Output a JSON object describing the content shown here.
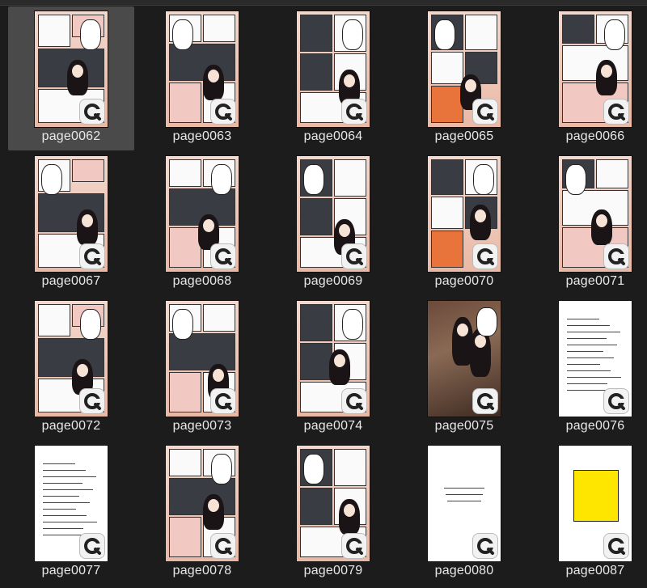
{
  "view": "thumbnail-grid",
  "selected_index": 0,
  "pages": [
    {
      "label": "page0062",
      "kind": "manga"
    },
    {
      "label": "page0063",
      "kind": "manga"
    },
    {
      "label": "page0064",
      "kind": "manga"
    },
    {
      "label": "page0065",
      "kind": "manga"
    },
    {
      "label": "page0066",
      "kind": "manga"
    },
    {
      "label": "page0067",
      "kind": "manga"
    },
    {
      "label": "page0068",
      "kind": "manga"
    },
    {
      "label": "page0069",
      "kind": "manga"
    },
    {
      "label": "page0070",
      "kind": "manga"
    },
    {
      "label": "page0071",
      "kind": "manga"
    },
    {
      "label": "page0072",
      "kind": "manga"
    },
    {
      "label": "page0073",
      "kind": "manga"
    },
    {
      "label": "page0074",
      "kind": "manga"
    },
    {
      "label": "page0075",
      "kind": "illustration"
    },
    {
      "label": "page0076",
      "kind": "text"
    },
    {
      "label": "page0077",
      "kind": "text"
    },
    {
      "label": "page0078",
      "kind": "manga"
    },
    {
      "label": "page0079",
      "kind": "manga"
    },
    {
      "label": "page0080",
      "kind": "chapter-title"
    },
    {
      "label": "page0087",
      "kind": "yellow-title"
    }
  ],
  "badge_icon": "clip-studio-icon",
  "colors": {
    "background": "#1c1c1c",
    "selected": "#4a4a4a",
    "label_text": "#e8e8e8",
    "yellow_card": "#ffe600"
  }
}
